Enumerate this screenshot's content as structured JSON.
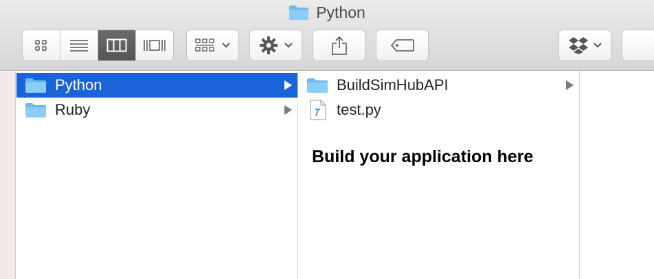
{
  "window": {
    "title": "Python",
    "title_icon": "folder-icon"
  },
  "toolbar": {
    "view_modes": [
      {
        "name": "icon-view",
        "icon": "grid-icon",
        "active": false
      },
      {
        "name": "list-view",
        "icon": "list-icon",
        "active": false
      },
      {
        "name": "column-view",
        "icon": "columns-icon",
        "active": true
      },
      {
        "name": "gallery-view",
        "icon": "gallery-icon",
        "active": false
      }
    ],
    "group_icon": "group-grid-icon",
    "action_icon": "gear-icon",
    "share_icon": "share-icon",
    "tag_icon": "tag-icon",
    "dropbox_icon": "dropbox-icon"
  },
  "columns": [
    {
      "items": [
        {
          "label": "Python",
          "type": "folder",
          "selected": true,
          "has_children": true
        },
        {
          "label": "Ruby",
          "type": "folder",
          "selected": false,
          "has_children": true
        }
      ]
    },
    {
      "items": [
        {
          "label": "BuildSimHubAPI",
          "type": "folder",
          "selected": false,
          "has_children": true
        },
        {
          "label": "test.py",
          "type": "python-file",
          "selected": false,
          "has_children": false
        }
      ],
      "message": "Build your application here"
    }
  ],
  "colors": {
    "selection": "#1a63d8",
    "folder": "#7ac3f5",
    "active_segment": "#5f5f5f"
  }
}
